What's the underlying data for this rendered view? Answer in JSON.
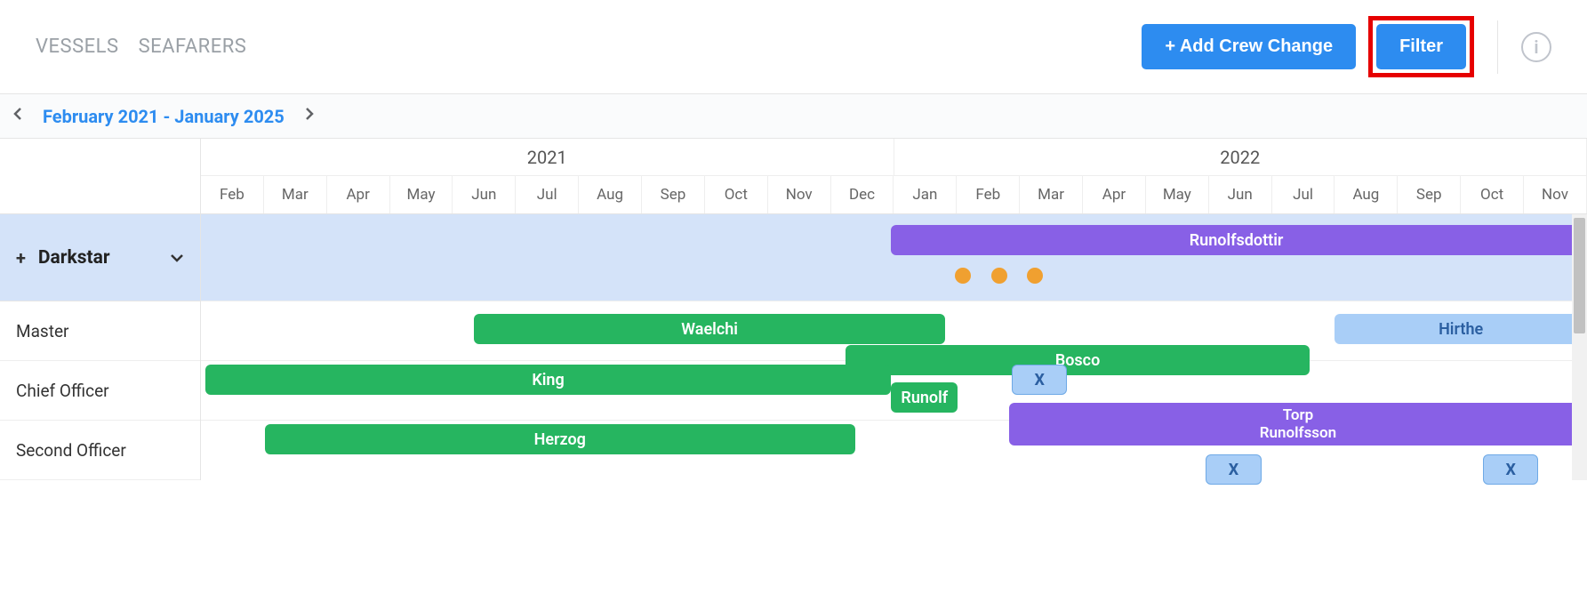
{
  "nav": {
    "tab1": "VESSELS",
    "tab2": "SEAFARERS"
  },
  "buttons": {
    "addCrew": "+ Add Crew Change",
    "filter": "Filter"
  },
  "dateRange": "February 2021 - January 2025",
  "years": [
    {
      "label": "2021",
      "months": 11
    },
    {
      "label": "2022",
      "months": 11
    }
  ],
  "months": [
    "Feb",
    "Mar",
    "Apr",
    "May",
    "Jun",
    "Jul",
    "Aug",
    "Sep",
    "Oct",
    "Nov",
    "Dec",
    "Jan",
    "Feb",
    "Mar",
    "Apr",
    "May",
    "Jun",
    "Jul",
    "Aug",
    "Sep",
    "Oct",
    "Nov"
  ],
  "vessel": {
    "name": "Darkstar"
  },
  "ranks": [
    "Master",
    "Chief Officer",
    "Second Officer"
  ],
  "bars": {
    "runolfsdottir": "Runolfsdottir",
    "waelchi": "Waelchi",
    "hirthe": "Hirthe",
    "king": "King",
    "bosco": "Bosco",
    "runolf": "Runolf",
    "herzog": "Herzog",
    "torp1": "Torp",
    "torp2": "Runolfsson",
    "x": "X"
  }
}
